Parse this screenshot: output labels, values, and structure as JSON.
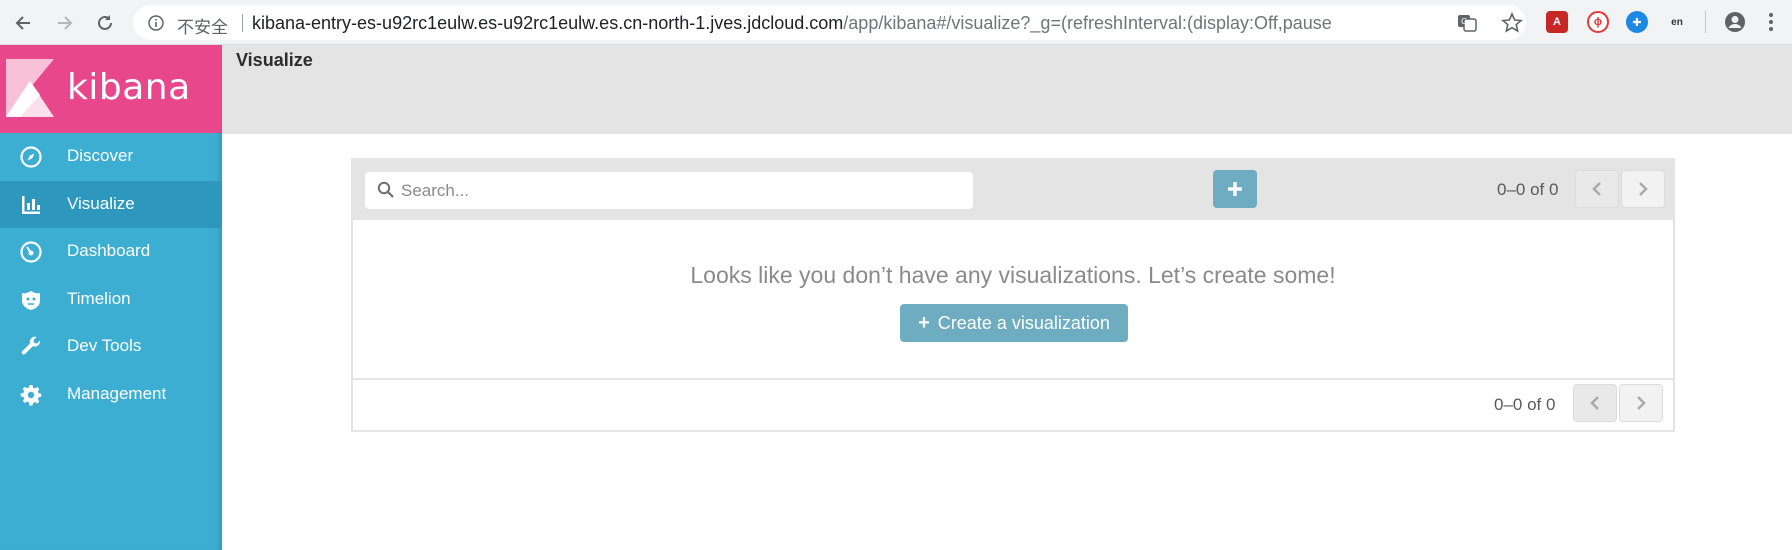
{
  "browser": {
    "insecure_label": "不安全",
    "url_host": "kibana-entry-es-u92rc1eulw.es-u92rc1eulw.es.cn-north-1.jves.jdcloud.com",
    "url_path": "/app/kibana#/visualize?_g=(refreshInterval:(display:Off,pause:!f,v...",
    "extensions": [
      {
        "name": "pdf-extension-icon",
        "color": "#c62828",
        "glyph": "A"
      },
      {
        "name": "flash-extension-icon",
        "color": "#e53935",
        "glyph": "ϕ"
      },
      {
        "name": "sync-extension-icon",
        "color": "#1e88e5",
        "glyph": "✚"
      },
      {
        "name": "translate-extension-icon",
        "color": "#333333",
        "glyph": "en"
      }
    ]
  },
  "sidebar": {
    "logo_text": "kibana",
    "items": [
      {
        "label": "Discover",
        "icon": "compass-icon",
        "active": false
      },
      {
        "label": "Visualize",
        "icon": "bar-chart-icon",
        "active": true
      },
      {
        "label": "Dashboard",
        "icon": "gauge-icon",
        "active": false
      },
      {
        "label": "Timelion",
        "icon": "timelion-icon",
        "active": false
      },
      {
        "label": "Dev Tools",
        "icon": "wrench-icon",
        "active": false
      },
      {
        "label": "Management",
        "icon": "gear-icon",
        "active": false
      }
    ]
  },
  "header": {
    "title": "Visualize"
  },
  "toolbar": {
    "search_placeholder": "Search...",
    "pager_text": "0–0 of 0"
  },
  "empty_state": {
    "message": "Looks like you don’t have any visualizations. Let’s create some!",
    "create_label": "Create a visualization"
  },
  "footer": {
    "pager_text": "0–0 of 0"
  },
  "colors": {
    "logo_bg": "#e8488b",
    "sidebar_bg": "#3caed2",
    "sidebar_active": "#2e97bd",
    "accent_button": "#6eadc1"
  }
}
